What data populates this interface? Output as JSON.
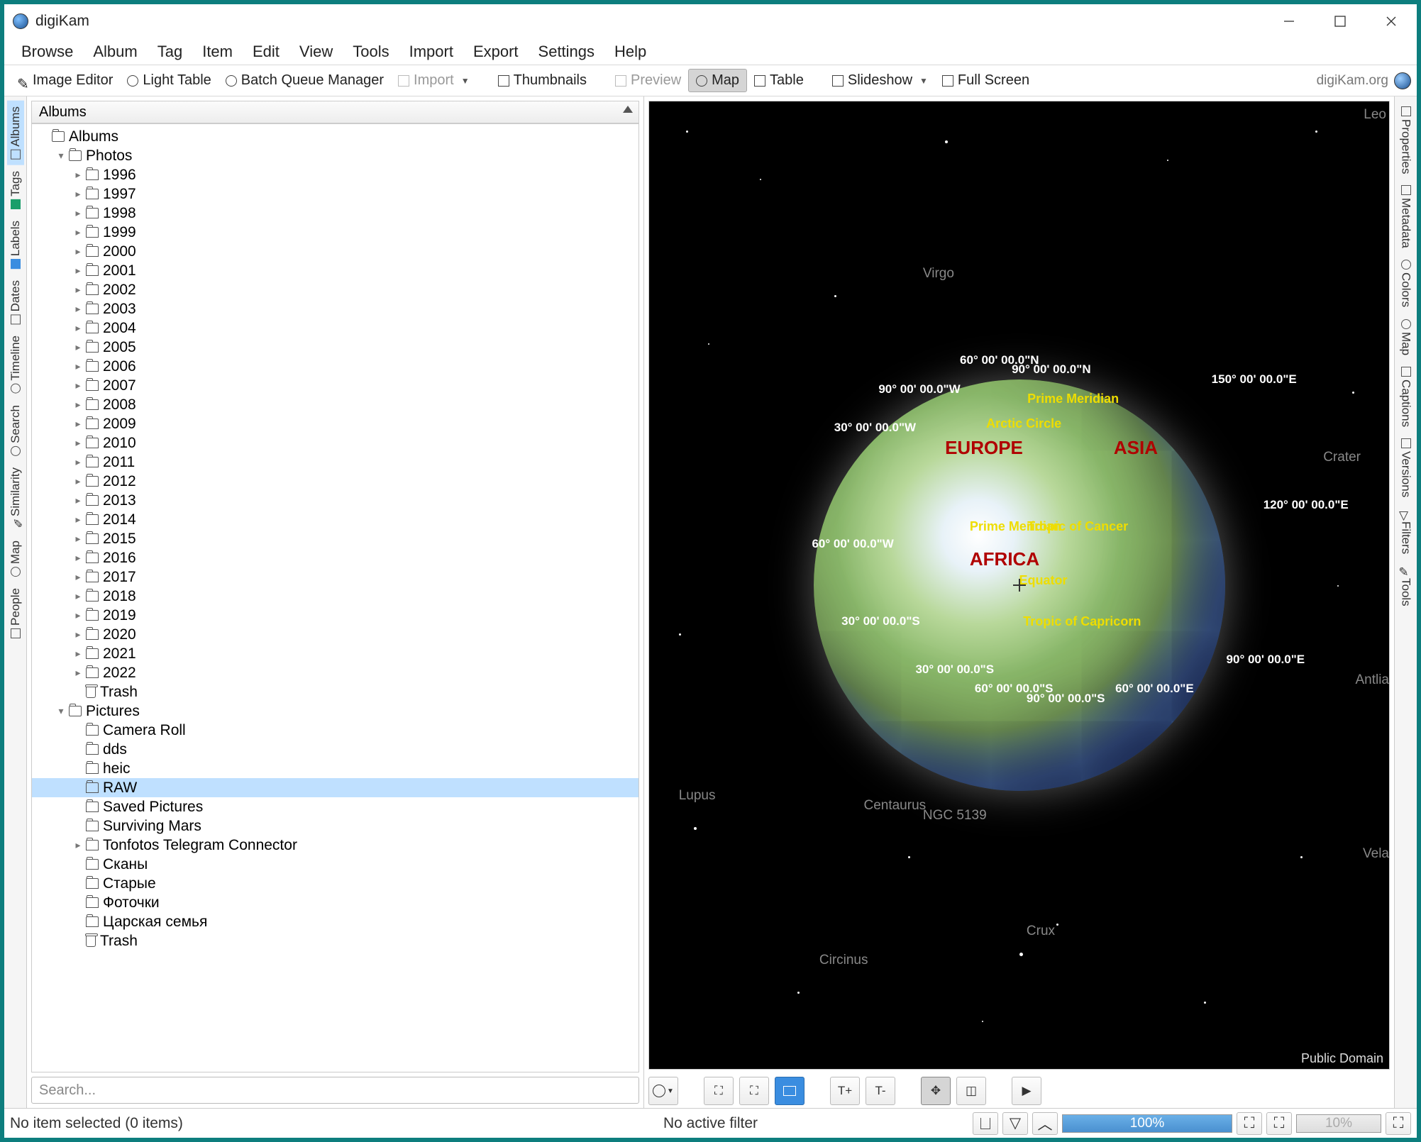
{
  "title": "digiKam",
  "menu": [
    "Browse",
    "Album",
    "Tag",
    "Item",
    "Edit",
    "View",
    "Tools",
    "Import",
    "Export",
    "Settings",
    "Help"
  ],
  "toolbar": {
    "image_editor": "Image Editor",
    "light_table": "Light Table",
    "batch_queue": "Batch Queue Manager",
    "import": "Import",
    "thumbnails": "Thumbnails",
    "preview": "Preview",
    "map": "Map",
    "table": "Table",
    "slideshow": "Slideshow",
    "fullscreen": "Full Screen",
    "brand": "digiKam.org"
  },
  "left_tabs": [
    "Albums",
    "Tags",
    "Labels",
    "Dates",
    "Timeline",
    "Search",
    "Similarity",
    "Map",
    "People"
  ],
  "right_tabs": [
    "Properties",
    "Metadata",
    "Colors",
    "Map",
    "Captions",
    "Versions",
    "Filters",
    "Tools"
  ],
  "panel_title": "Albums",
  "tree": {
    "root": "Albums",
    "photos": {
      "label": "Photos",
      "years": [
        "1996",
        "1997",
        "1998",
        "1999",
        "2000",
        "2001",
        "2002",
        "2003",
        "2004",
        "2005",
        "2006",
        "2007",
        "2008",
        "2009",
        "2010",
        "2011",
        "2012",
        "2013",
        "2014",
        "2015",
        "2016",
        "2017",
        "2018",
        "2019",
        "2020",
        "2021",
        "2022"
      ],
      "trash": "Trash"
    },
    "pictures": {
      "label": "Pictures",
      "items": [
        "Camera Roll",
        "dds",
        "heic",
        "RAW",
        "Saved Pictures",
        "Surviving Mars",
        "Tonfotos Telegram Connector",
        "Сканы",
        "Старые",
        "Фоточки",
        "Царская семья"
      ],
      "trash": "Trash"
    },
    "selected": "RAW"
  },
  "search_placeholder": "Search...",
  "map": {
    "continents": {
      "europe": "EUROPE",
      "asia": "ASIA",
      "africa": "AFRICA"
    },
    "lines": {
      "arctic": "Arctic Circle",
      "cancer": "Tropic of Cancer",
      "equator": "Equator",
      "capricorn": "Tropic of Capricorn",
      "pm_top": "Prime Meridian",
      "pm_mid": "Prime Meridian"
    },
    "coords": {
      "c60n": "60° 00' 00.0\"N",
      "c90n": "90° 00' 00.0\"N",
      "c150e": "150° 00' 00.0\"E",
      "c90w": "90° 00' 00.0\"W",
      "c30w": "30° 00' 00.0\"W",
      "c120e": "120° 00' 00.0\"E",
      "c60w": "60° 00' 00.0\"W",
      "c30s": "30° 00' 00.0\"S",
      "c90e": "90° 00' 00.0\"E",
      "c30s2": "30° 00' 00.0\"S",
      "c60s": "60° 00' 00.0\"S",
      "c90s": "90° 00' 00.0\"S",
      "c60e": "60° 00' 00.0\"E"
    },
    "constellations": {
      "leo": "Leo",
      "virgo": "Virgo",
      "crater": "Crater",
      "antlia": "Antlia",
      "lupus": "Lupus",
      "centaurus": "Centaurus",
      "ngc": "NGC 5139",
      "vela": "Vela",
      "crux": "Crux",
      "circinus": "Circinus"
    },
    "attribution": "Public Domain",
    "toolbar_text": {
      "tplus": "T+",
      "tminus": "T-",
      "play": "▶"
    }
  },
  "status": {
    "selection": "No item selected (0 items)",
    "filter": "No active filter",
    "zoom": "100%",
    "zoom2": "10%"
  }
}
